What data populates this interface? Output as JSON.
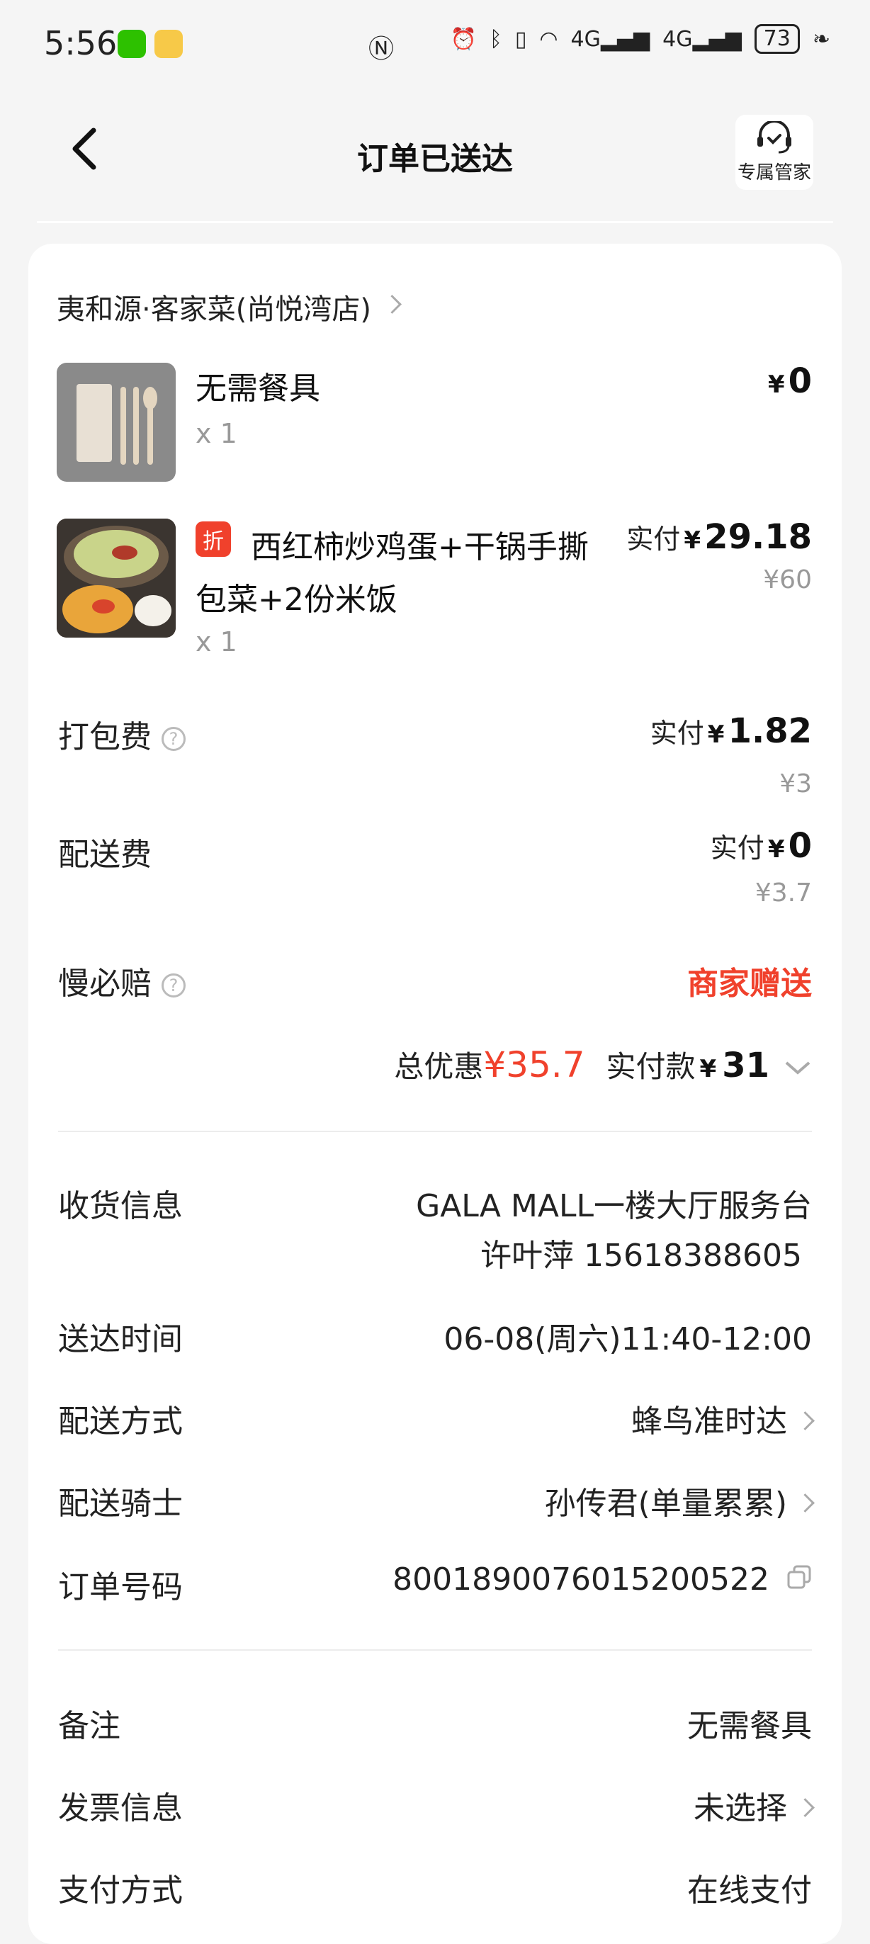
{
  "status_bar": {
    "time": "5:56",
    "network1": "4G",
    "network2": "4G",
    "battery": "73"
  },
  "header": {
    "title": "订单已送达",
    "butler_label": "专属管家"
  },
  "shop": {
    "name": "夷和源·客家菜(尚悦湾店)"
  },
  "items": [
    {
      "name": "无需餐具",
      "qty": "x 1",
      "currency": "¥",
      "price": "0"
    },
    {
      "badge": "折",
      "name_line1": "西红柿炒鸡蛋+干锅手撕",
      "name_line2": "包菜+2份米饭",
      "qty": "x 1",
      "pay_label": "实付",
      "currency": "¥",
      "price": "29.18",
      "original": "¥60"
    }
  ],
  "fees": {
    "packing": {
      "label": "打包费",
      "pay_label": "实付",
      "currency": "¥",
      "price": "1.82",
      "original": "¥3"
    },
    "delivery": {
      "label": "配送费",
      "pay_label": "实付",
      "currency": "¥",
      "price": "0",
      "original": "¥3.7"
    },
    "slow": {
      "label": "慢必赔",
      "value": "商家赠送"
    }
  },
  "summary": {
    "discount_label": "总优惠",
    "discount_value": "¥35.7",
    "paid_label": "实付款",
    "currency": "¥",
    "paid_value": "31"
  },
  "info": {
    "receiver_label": "收货信息",
    "receiver_address": "GALA MALL一楼大厅服务台",
    "receiver_contact": "许叶萍 15618388605",
    "time_label": "送达时间",
    "time_value": "06-08(周六)11:40-12:00",
    "method_label": "配送方式",
    "method_value": "蜂鸟准时达",
    "rider_label": "配送骑士",
    "rider_value": "孙传君(单量累累)",
    "order_label": "订单号码",
    "order_value": "8001890076015200522"
  },
  "extra": {
    "remark_label": "备注",
    "remark_value": "无需餐具",
    "invoice_label": "发票信息",
    "invoice_value": "未选择",
    "pay_method_label": "支付方式",
    "pay_method_value": "在线支付"
  },
  "colors": {
    "accent_red": "#f0412c",
    "bg": "#f5f5f5",
    "card": "#ffffff"
  }
}
